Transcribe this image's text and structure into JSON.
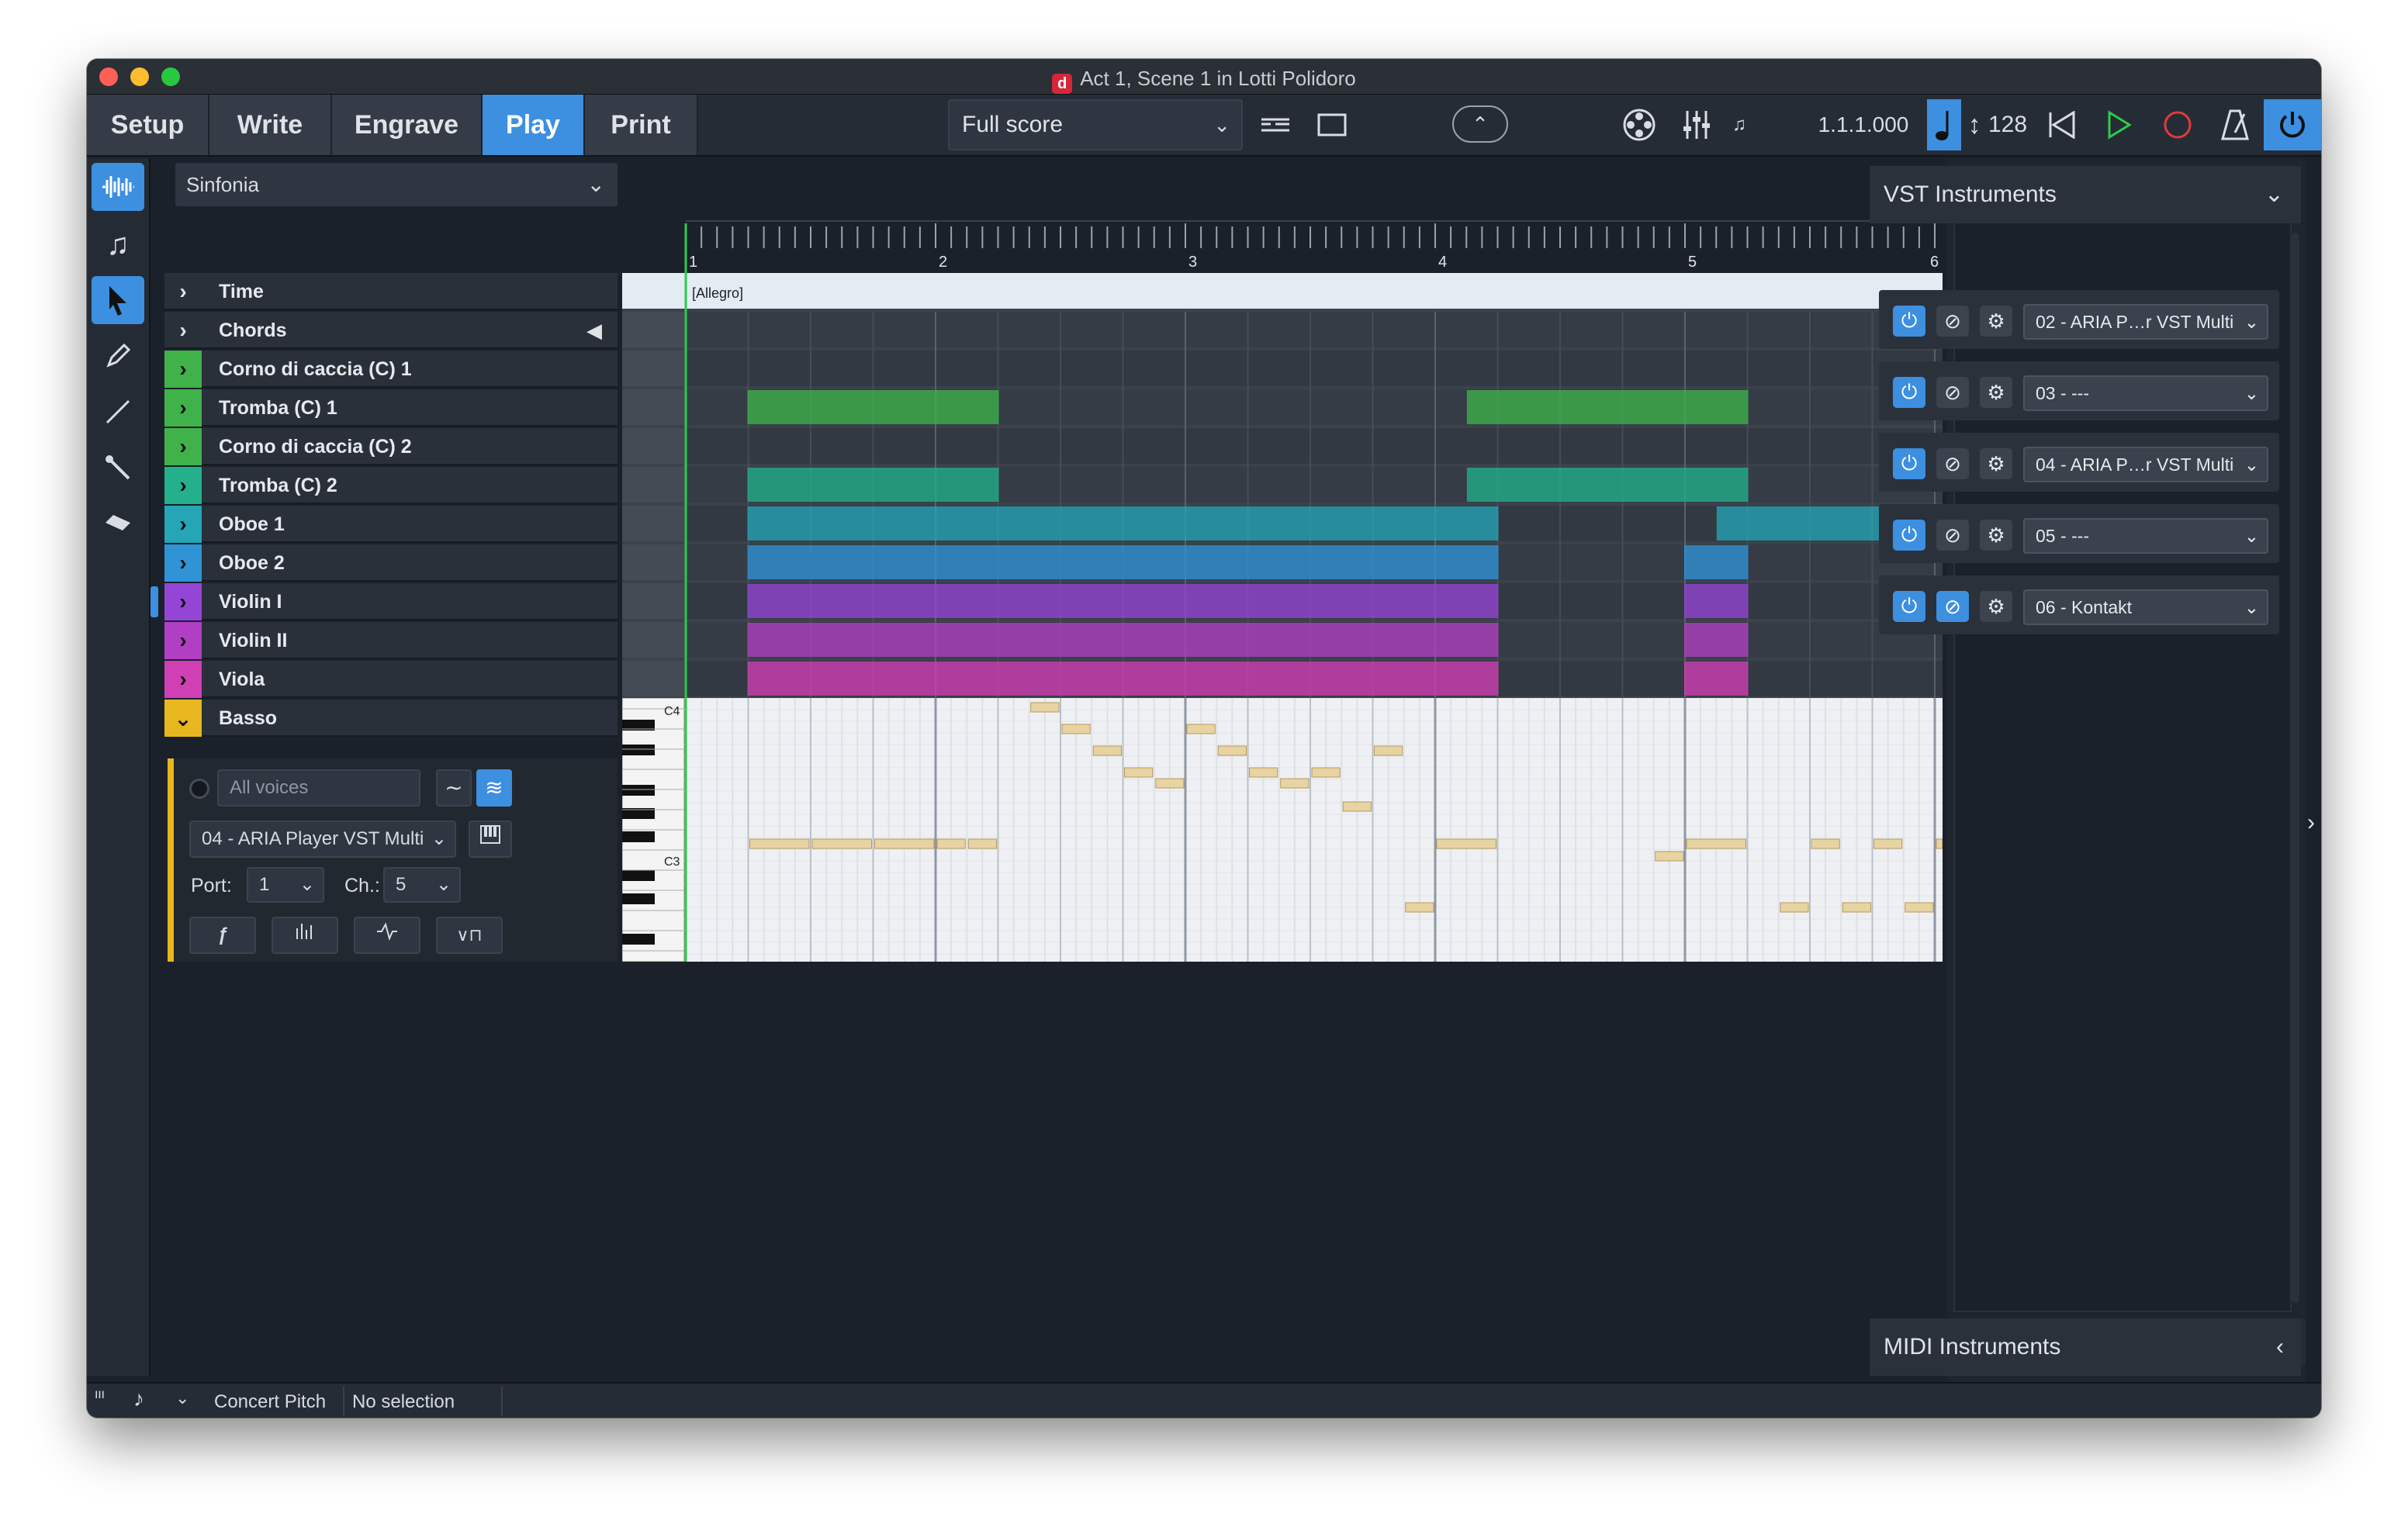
{
  "window": {
    "title": "Act 1, Scene 1 in Lotti Polidoro"
  },
  "modes": [
    {
      "label": "Setup",
      "active": false
    },
    {
      "label": "Write",
      "active": false
    },
    {
      "label": "Engrave",
      "active": false
    },
    {
      "label": "Play",
      "active": true
    },
    {
      "label": "Print",
      "active": false
    }
  ],
  "toolbar": {
    "layout_select": "Full score",
    "position": "1.1.1.000",
    "tempo": "128"
  },
  "flow": {
    "selected": "Sinfonia"
  },
  "tracks": [
    {
      "name": "Time",
      "color": "",
      "style": "dark"
    },
    {
      "name": "Chords",
      "color": "",
      "style": "dark"
    },
    {
      "name": "Corno di caccia (C) 1",
      "color": "#3fb24a"
    },
    {
      "name": "Tromba (C) 1",
      "color": "#3fb24a"
    },
    {
      "name": "Corno di caccia (C) 2",
      "color": "#3fb24a"
    },
    {
      "name": "Tromba (C) 2",
      "color": "#23b08a"
    },
    {
      "name": "Oboe 1",
      "color": "#25a5b5"
    },
    {
      "name": "Oboe 2",
      "color": "#2f93d6"
    },
    {
      "name": "Violin I",
      "color": "#9445d6"
    },
    {
      "name": "Violin II",
      "color": "#b13fc4"
    },
    {
      "name": "Viola",
      "color": "#d13fb4"
    },
    {
      "name": "Basso",
      "color": "#e8b71f"
    }
  ],
  "basso": {
    "voices_placeholder": "All voices",
    "instrument": "04 - ARIA Player VST Multi",
    "port_label": "Port:",
    "port_value": "1",
    "channel_label": "Ch.:",
    "channel_value": "5"
  },
  "ruler": {
    "bars": [
      "1",
      "2",
      "3",
      "4",
      "5",
      "6"
    ],
    "tempo_text": "[Allegro]"
  },
  "piano_roll": {
    "c4_label": "C4",
    "c3_label": "C3"
  },
  "vst_panel": {
    "title": "VST Instruments",
    "instruments": [
      {
        "label": "02 - ARIA P…r VST Multi",
        "edit_active": false
      },
      {
        "label": "03 - ---",
        "edit_active": false
      },
      {
        "label": "04 - ARIA P…r VST Multi",
        "edit_active": false
      },
      {
        "label": "05 - ---",
        "edit_active": false
      },
      {
        "label": "06 - Kontakt",
        "edit_active": true
      }
    ]
  },
  "midi_panel": {
    "title": "MIDI Instruments"
  },
  "statusbar": {
    "concert_pitch": "Concert Pitch",
    "selection": "No selection"
  },
  "colors": {
    "accent": "#3d8fe0",
    "green": "#3fb24a",
    "teal": "#23b08a",
    "cyan": "#25a5b5",
    "blue": "#2f93d6",
    "purple": "#9445d6",
    "magenta": "#b13fc4",
    "pink": "#d13fb4",
    "yellow": "#e8b71f",
    "note": "#e8d3a2"
  }
}
